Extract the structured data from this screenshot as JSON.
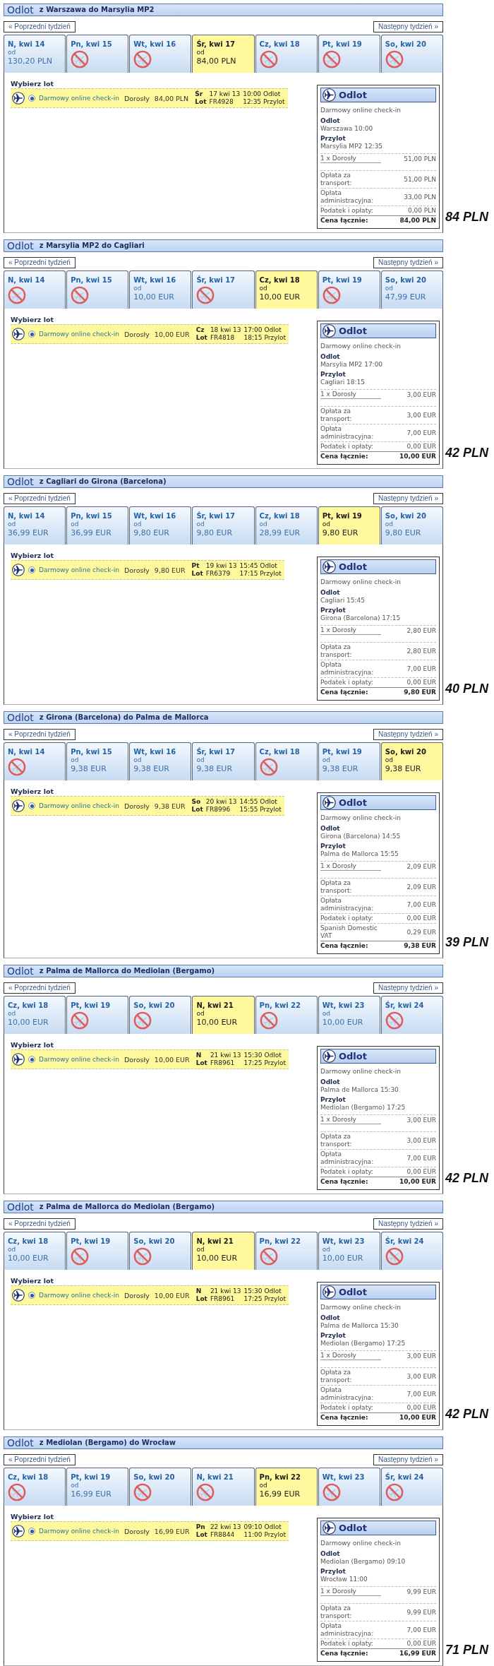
{
  "sections": [
    {
      "title": "Odlot",
      "route": "z Warszawa do Marsylia MP2",
      "prev_week": "« Poprzedni tydzień",
      "next_week": "Następny tydzień »",
      "days": [
        {
          "kind": "fare",
          "label": "N, kwi 14",
          "from": "od",
          "price": "130,20 PLN",
          "selected": false
        },
        {
          "kind": "none",
          "label": "Pn, kwi 15",
          "selected": false
        },
        {
          "kind": "none",
          "label": "Wt, kwi 16",
          "selected": false
        },
        {
          "kind": "fare",
          "label": "Śr, kwi 17",
          "from": "od",
          "price": "84,00 PLN",
          "selected": true
        },
        {
          "kind": "none",
          "label": "Cz, kwi 18",
          "selected": false
        },
        {
          "kind": "none",
          "label": "Pt, kwi 19",
          "selected": false
        },
        {
          "kind": "none",
          "label": "So, kwi 20",
          "selected": false
        }
      ],
      "choose_label": "Wybierz lot",
      "flights": [
        {
          "selected": true,
          "service": "Darmowy online check-in",
          "passenger": "Dorosły",
          "price": "84,00 PLN",
          "day": "Śr",
          "date": "17 kwi 13",
          "departure": "10:00 Odlot",
          "flight_label": "Lot",
          "number": "FR4928",
          "arrival": "12:35 Przylot"
        }
      ],
      "summary": {
        "title": "Odlot",
        "service": "Darmowy online check-in",
        "departure_label": "Odlot",
        "departure": "Warszawa 10:00",
        "arrival_label": "Przylot",
        "arrival": "Marsylia MP2 12:35",
        "passengers": [
          {
            "label": "1 x Dorosły",
            "amount": "51,00 PLN"
          }
        ],
        "fees": [
          {
            "label": "Opłata za transport:",
            "amount": "51,00 PLN"
          },
          {
            "label": "Opłata administracyjna:",
            "amount": "33,00 PLN"
          },
          {
            "label": "Podatek i opłaty:",
            "amount": "0,00 PLN"
          }
        ],
        "total": {
          "label": "Cena łącznie:",
          "amount": "84,00 PLN"
        }
      },
      "note": "84 PLN"
    },
    {
      "title": "Odlot",
      "route": "z Marsylia MP2 do Cagliari",
      "prev_week": "« Poprzedni tydzień",
      "next_week": "Następny tydzień »",
      "days": [
        {
          "kind": "none",
          "label": "N, kwi 14",
          "selected": false
        },
        {
          "kind": "none",
          "label": "Pn, kwi 15",
          "selected": false
        },
        {
          "kind": "fare",
          "label": "Wt, kwi 16",
          "from": "od",
          "price": "10,00 EUR",
          "selected": false
        },
        {
          "kind": "none",
          "label": "Śr, kwi 17",
          "selected": false
        },
        {
          "kind": "fare",
          "label": "Cz, kwi 18",
          "from": "od",
          "price": "10,00 EUR",
          "selected": true
        },
        {
          "kind": "none",
          "label": "Pt, kwi 19",
          "selected": false
        },
        {
          "kind": "fare",
          "label": "So, kwi 20",
          "from": "od",
          "price": "47,99 EUR",
          "selected": false
        }
      ],
      "choose_label": "Wybierz lot",
      "flights": [
        {
          "selected": true,
          "service": "Darmowy online check-in",
          "passenger": "Dorosły",
          "price": "10,00 EUR",
          "day": "Cz",
          "date": "18 kwi 13",
          "departure": "17:00 Odlot",
          "flight_label": "Lot",
          "number": "FR4818",
          "arrival": "18:15 Przylot"
        }
      ],
      "summary": {
        "title": "Odlot",
        "service": "Darmowy online check-in",
        "departure_label": "Odlot",
        "departure": "Marsylia MP2 17:00",
        "arrival_label": "Przylot",
        "arrival": "Cagliari 18:15",
        "passengers": [
          {
            "label": "1 x Dorosły",
            "amount": "3,00 EUR"
          }
        ],
        "fees": [
          {
            "label": "Opłata za transport:",
            "amount": "3,00 EUR"
          },
          {
            "label": "Opłata administracyjna:",
            "amount": "7,00 EUR"
          },
          {
            "label": "Podatek i opłaty:",
            "amount": "0,00 EUR"
          }
        ],
        "total": {
          "label": "Cena łącznie:",
          "amount": "10,00 EUR"
        }
      },
      "note": "42 PLN"
    },
    {
      "title": "Odlot",
      "route": "z Cagliari do Girona (Barcelona)",
      "prev_week": "« Poprzedni tydzień",
      "next_week": "Następny tydzień »",
      "days": [
        {
          "kind": "fare",
          "label": "N, kwi 14",
          "from": "od",
          "price": "36,99 EUR",
          "selected": false
        },
        {
          "kind": "fare",
          "label": "Pn, kwi 15",
          "from": "od",
          "price": "36,99 EUR",
          "selected": false
        },
        {
          "kind": "fare",
          "label": "Wt, kwi 16",
          "from": "od",
          "price": "9,80 EUR",
          "selected": false
        },
        {
          "kind": "fare",
          "label": "Śr, kwi 17",
          "from": "od",
          "price": "9,80 EUR",
          "selected": false
        },
        {
          "kind": "fare",
          "label": "Cz, kwi 18",
          "from": "od",
          "price": "28,99 EUR",
          "selected": false
        },
        {
          "kind": "fare",
          "label": "Pt, kwi 19",
          "from": "od",
          "price": "9,80 EUR",
          "selected": true
        },
        {
          "kind": "fare",
          "label": "So, kwi 20",
          "from": "od",
          "price": "9,80 EUR",
          "selected": false
        }
      ],
      "choose_label": "Wybierz lot",
      "flights": [
        {
          "selected": true,
          "service": "Darmowy online check-in",
          "passenger": "Dorosły",
          "price": "9,80 EUR",
          "day": "Pt",
          "date": "19 kwi 13",
          "departure": "15:45 Odlot",
          "flight_label": "Lot",
          "number": "FR6379",
          "arrival": "17:15 Przylot"
        }
      ],
      "summary": {
        "title": "Odlot",
        "service": "Darmowy online check-in",
        "departure_label": "Odlot",
        "departure": "Cagliari 15:45",
        "arrival_label": "Przylot",
        "arrival": "Girona (Barcelona) 17:15",
        "passengers": [
          {
            "label": "1 x Dorosły",
            "amount": "2,80 EUR"
          }
        ],
        "fees": [
          {
            "label": "Opłata za transport:",
            "amount": "2,80 EUR"
          },
          {
            "label": "Opłata administracyjna:",
            "amount": "7,00 EUR"
          },
          {
            "label": "Podatek i opłaty:",
            "amount": "0,00 EUR"
          }
        ],
        "total": {
          "label": "Cena łącznie:",
          "amount": "9,80 EUR"
        }
      },
      "note": "40 PLN"
    },
    {
      "title": "Odlot",
      "route": "z Girona (Barcelona) do Palma de Mallorca",
      "prev_week": "« Poprzedni tydzień",
      "next_week": "Następny tydzień »",
      "days": [
        {
          "kind": "none",
          "label": "N, kwi 14",
          "selected": false
        },
        {
          "kind": "fare",
          "label": "Pn, kwi 15",
          "from": "od",
          "price": "9,38 EUR",
          "selected": false
        },
        {
          "kind": "fare",
          "label": "Wt, kwi 16",
          "from": "od",
          "price": "9,38 EUR",
          "selected": false
        },
        {
          "kind": "fare",
          "label": "Śr, kwi 17",
          "from": "od",
          "price": "9,38 EUR",
          "selected": false
        },
        {
          "kind": "none",
          "label": "Cz, kwi 18",
          "selected": false
        },
        {
          "kind": "fare",
          "label": "Pt, kwi 19",
          "from": "od",
          "price": "9,38 EUR",
          "selected": false
        },
        {
          "kind": "fare",
          "label": "So, kwi 20",
          "from": "od",
          "price": "9,38 EUR",
          "selected": true
        }
      ],
      "choose_label": "Wybierz lot",
      "flights": [
        {
          "selected": true,
          "service": "Darmowy online check-in",
          "passenger": "Dorosły",
          "price": "9,38 EUR",
          "day": "So",
          "date": "20 kwi 13",
          "departure": "14:55 Odlot",
          "flight_label": "Lot",
          "number": "FR8996",
          "arrival": "15:55 Przylot"
        }
      ],
      "summary": {
        "title": "Odlot",
        "service": "Darmowy online check-in",
        "departure_label": "Odlot",
        "departure": "Girona (Barcelona) 14:55",
        "arrival_label": "Przylot",
        "arrival": "Palma de Mallorca 15:55",
        "passengers": [
          {
            "label": "1 x Dorosły",
            "amount": "2,09 EUR"
          }
        ],
        "fees": [
          {
            "label": "Opłata za transport:",
            "amount": "2,09 EUR"
          },
          {
            "label": "Opłata administracyjna:",
            "amount": "7,00 EUR"
          },
          {
            "label": "Podatek i opłaty:",
            "amount": "0,00 EUR"
          },
          {
            "label": "Spanish Domestic VAT",
            "amount": "0,29 EUR"
          }
        ],
        "total": {
          "label": "Cena łącznie:",
          "amount": "9,38 EUR"
        }
      },
      "note": "39 PLN"
    },
    {
      "title": "Odlot",
      "route": "z Palma de Mallorca do Mediolan (Bergamo)",
      "prev_week": "« Poprzedni tydzień",
      "next_week": "Następny tydzień »",
      "days": [
        {
          "kind": "fare",
          "label": "Cz, kwi 18",
          "from": "od",
          "price": "10,00 EUR",
          "selected": false
        },
        {
          "kind": "none",
          "label": "Pt, kwi 19",
          "selected": false
        },
        {
          "kind": "none",
          "label": "So, kwi 20",
          "selected": false
        },
        {
          "kind": "fare",
          "label": "N, kwi 21",
          "from": "od",
          "price": "10,00 EUR",
          "selected": true
        },
        {
          "kind": "none",
          "label": "Pn, kwi 22",
          "selected": false
        },
        {
          "kind": "fare",
          "label": "Wt, kwi 23",
          "from": "od",
          "price": "10,00 EUR",
          "selected": false
        },
        {
          "kind": "none",
          "label": "Śr, kwi 24",
          "selected": false
        }
      ],
      "choose_label": "Wybierz lot",
      "flights": [
        {
          "selected": true,
          "service": "Darmowy online check-in",
          "passenger": "Dorosły",
          "price": "10,00 EUR",
          "day": "N",
          "date": "21 kwi 13",
          "departure": "15:30 Odlot",
          "flight_label": "Lot",
          "number": "FR8961",
          "arrival": "17:25 Przylot"
        }
      ],
      "summary": {
        "title": "Odlot",
        "service": "Darmowy online check-in",
        "departure_label": "Odlot",
        "departure": "Palma de Mallorca 15:30",
        "arrival_label": "Przylot",
        "arrival": "Mediolan (Bergamo) 17:25",
        "passengers": [
          {
            "label": "1 x Dorosły",
            "amount": "3,00 EUR"
          }
        ],
        "fees": [
          {
            "label": "Opłata za transport:",
            "amount": "3,00 EUR"
          },
          {
            "label": "Opłata administracyjna:",
            "amount": "7,00 EUR"
          },
          {
            "label": "Podatek i opłaty:",
            "amount": "0,00 EUR"
          }
        ],
        "total": {
          "label": "Cena łącznie:",
          "amount": "10,00 EUR"
        }
      },
      "note": "42 PLN"
    },
    {
      "title": "Odlot",
      "route": "z Palma de Mallorca do Mediolan (Bergamo)",
      "prev_week": "« Poprzedni tydzień",
      "next_week": "Następny tydzień »",
      "days": [
        {
          "kind": "fare",
          "label": "Cz, kwi 18",
          "from": "od",
          "price": "10,00 EUR",
          "selected": false
        },
        {
          "kind": "none",
          "label": "Pt, kwi 19",
          "selected": false
        },
        {
          "kind": "none",
          "label": "So, kwi 20",
          "selected": false
        },
        {
          "kind": "fare",
          "label": "N, kwi 21",
          "from": "od",
          "price": "10,00 EUR",
          "selected": true
        },
        {
          "kind": "none",
          "label": "Pn, kwi 22",
          "selected": false
        },
        {
          "kind": "fare",
          "label": "Wt, kwi 23",
          "from": "od",
          "price": "10,00 EUR",
          "selected": false
        },
        {
          "kind": "none",
          "label": "Śr, kwi 24",
          "selected": false
        }
      ],
      "choose_label": "Wybierz lot",
      "flights": [
        {
          "selected": true,
          "service": "Darmowy online check-in",
          "passenger": "Dorosły",
          "price": "10,00 EUR",
          "day": "N",
          "date": "21 kwi 13",
          "departure": "15:30 Odlot",
          "flight_label": "Lot",
          "number": "FR8961",
          "arrival": "17:25 Przylot"
        }
      ],
      "summary": {
        "title": "Odlot",
        "service": "Darmowy online check-in",
        "departure_label": "Odlot",
        "departure": "Palma de Mallorca 15:30",
        "arrival_label": "Przylot",
        "arrival": "Mediolan (Bergamo) 17:25",
        "passengers": [
          {
            "label": "1 x Dorosły",
            "amount": "3,00 EUR"
          }
        ],
        "fees": [
          {
            "label": "Opłata za transport:",
            "amount": "3,00 EUR"
          },
          {
            "label": "Opłata administracyjna:",
            "amount": "7,00 EUR"
          },
          {
            "label": "Podatek i opłaty:",
            "amount": "0,00 EUR"
          }
        ],
        "total": {
          "label": "Cena łącznie:",
          "amount": "10,00 EUR"
        }
      },
      "note": "42 PLN"
    },
    {
      "title": "Odlot",
      "route": "z Mediolan (Bergamo) do Wrocław",
      "prev_week": "« Poprzedni tydzień",
      "next_week": "Następny tydzień »",
      "days": [
        {
          "kind": "none",
          "label": "Cz, kwi 18",
          "selected": false
        },
        {
          "kind": "fare",
          "label": "Pt, kwi 19",
          "from": "od",
          "price": "16,99 EUR",
          "selected": false
        },
        {
          "kind": "none",
          "label": "So, kwi 20",
          "selected": false
        },
        {
          "kind": "none",
          "label": "N, kwi 21",
          "selected": false
        },
        {
          "kind": "fare",
          "label": "Pn, kwi 22",
          "from": "od",
          "price": "16,99 EUR",
          "selected": true
        },
        {
          "kind": "none",
          "label": "Wt, kwi 23",
          "selected": false
        },
        {
          "kind": "none",
          "label": "Śr, kwi 24",
          "selected": false
        }
      ],
      "choose_label": "Wybierz lot",
      "flights": [
        {
          "selected": true,
          "service": "Darmowy online check-in",
          "passenger": "Dorosły",
          "price": "16,99 EUR",
          "day": "Pn",
          "date": "22 kwi 13",
          "departure": "09:10 Odlot",
          "flight_label": "Lot",
          "number": "FR8844",
          "arrival": "11:00 Przylot"
        }
      ],
      "summary": {
        "title": "Odlot",
        "service": "Darmowy online check-in",
        "departure_label": "Odlot",
        "departure": "Mediolan (Bergamo) 09:10",
        "arrival_label": "Przylot",
        "arrival": "Wrocław 11:00",
        "passengers": [
          {
            "label": "1 x Dorosły",
            "amount": "9,99 EUR"
          }
        ],
        "fees": [
          {
            "label": "Opłata za transport:",
            "amount": "9,99 EUR"
          },
          {
            "label": "Opłata administracyjna:",
            "amount": "7,00 EUR"
          },
          {
            "label": "Podatek i opłaty:",
            "amount": "0,00 EUR"
          }
        ],
        "total": {
          "label": "Cena łącznie:",
          "amount": "16,99 EUR"
        }
      },
      "note": "71 PLN"
    }
  ]
}
